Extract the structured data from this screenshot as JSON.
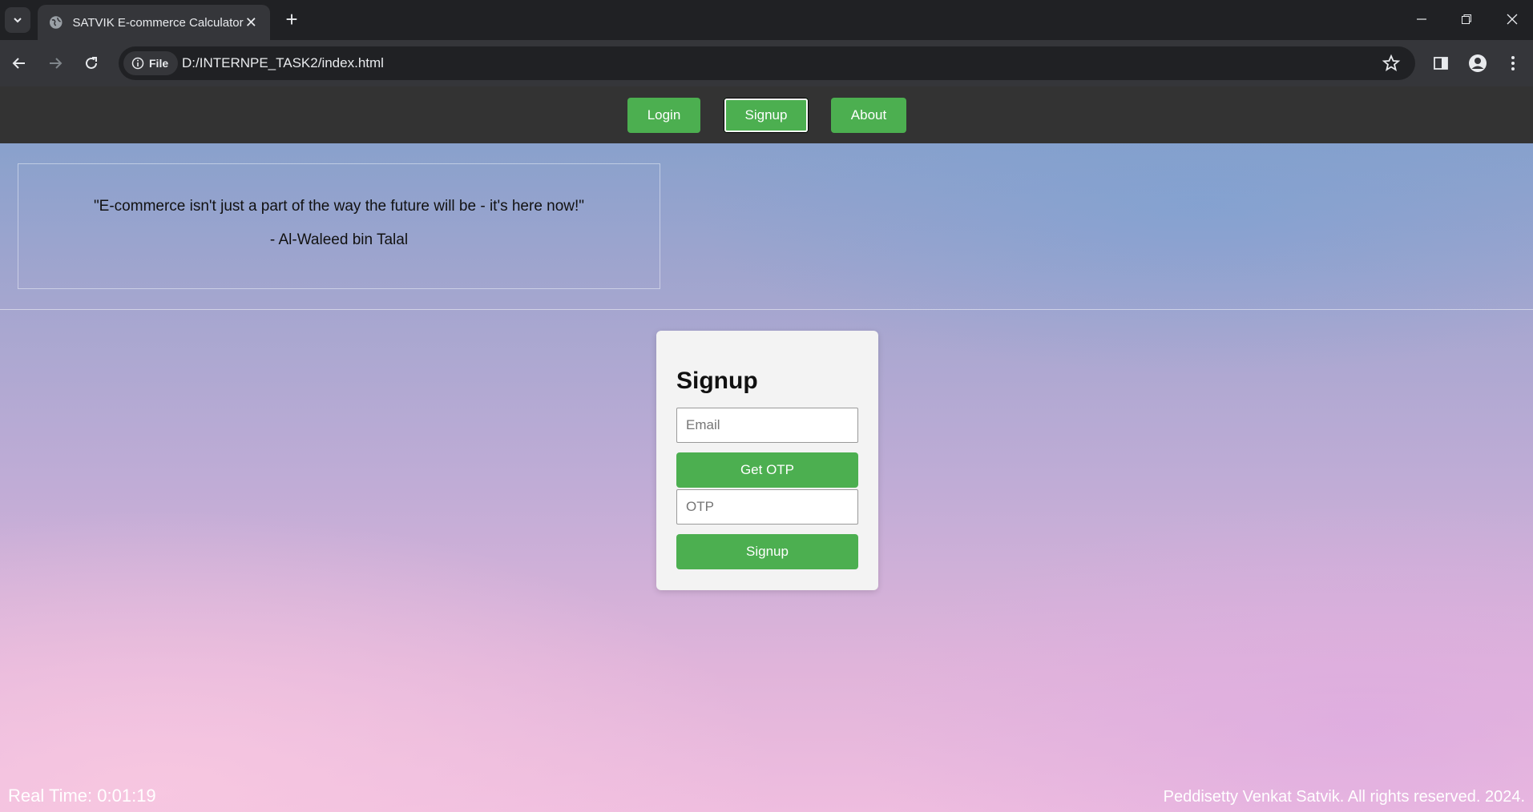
{
  "browser": {
    "tab_title": "SATVIK E-commerce Calculator",
    "close_glyph": "✕",
    "new_tab_glyph": "+",
    "site_info_label": "File",
    "url": "D:/INTERNPE_TASK2/index.html"
  },
  "nav": {
    "items": [
      {
        "label": "Login"
      },
      {
        "label": "Signup"
      },
      {
        "label": "About"
      }
    ]
  },
  "quote": {
    "text": "\"E-commerce isn't just a part of the way the future will be - it's here now!\"",
    "author": "- Al-Waleed bin Talal"
  },
  "signup": {
    "title": "Signup",
    "email_placeholder": "Email",
    "get_otp_label": "Get OTP",
    "otp_placeholder": "OTP",
    "submit_label": "Signup"
  },
  "footer": {
    "real_time": "Real Time: 0:01:19",
    "copyright": "Peddisetty Venkat Satvik. All rights reserved. 2024."
  },
  "colors": {
    "accent_green": "#4caf50",
    "nav_bg": "#333333",
    "browser_bg": "#202124"
  }
}
